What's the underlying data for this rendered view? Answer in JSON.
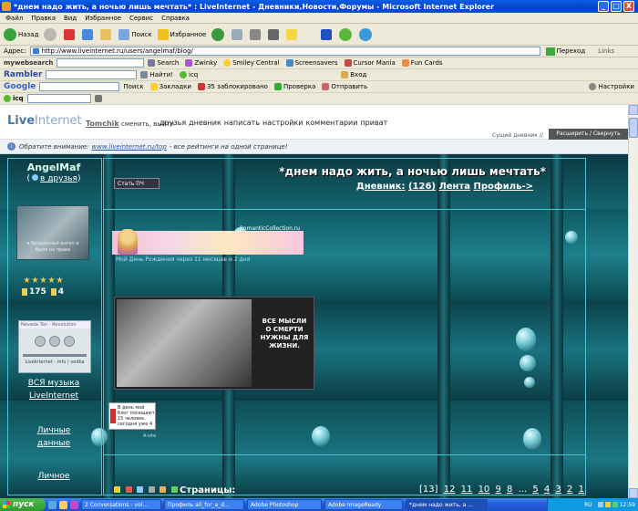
{
  "window": {
    "title": "*днем надо жить, а ночью лишь мечтать* : LiveInternet - Дневники,Новости,Форумы - Microsoft Internet Explorer",
    "controls": [
      "_",
      "□",
      "X"
    ]
  },
  "menu": [
    "Файл",
    "Правка",
    "Вид",
    "Избранное",
    "Сервис",
    "Справка"
  ],
  "toolbar": {
    "back": "Назад",
    "search": "Поиск",
    "favorites": "Избранное"
  },
  "address": {
    "label": "Адрес:",
    "url": "http://www.liveinternet.ru/users/angelmaf/blog/",
    "go": "Переход",
    "links": "Links"
  },
  "mywebsearch": {
    "brand": "mywebsearch",
    "search": "Search",
    "items": [
      "Zwinky",
      "Smiley Central",
      "Screensavers",
      "Cursor Mania",
      "Fun Cards"
    ]
  },
  "rambler": {
    "brand": "Rambler",
    "find": "Найти!",
    "icq": "icq",
    "login": "Вход"
  },
  "google": {
    "brand": "Google",
    "search": "Поиск",
    "bookmarks": "Закладки",
    "blocked": "35 заблокировано",
    "check": "Проверка",
    "send": "Отправить",
    "settings": "Настройки"
  },
  "icqbar": {
    "brand": "icq"
  },
  "liveinternet": {
    "logo_a": "Live",
    "logo_b": "Internet",
    "user": "Tomchik",
    "user_actions": "сменить, выйти",
    "nav": [
      "друзья",
      "дневник",
      "написать",
      "настройки",
      "комментарии",
      "приват"
    ],
    "diary_type": "Сущий дневник //",
    "expand": "Расширить / Свернуть"
  },
  "notice": {
    "prefix": "Обратите внимание:",
    "link": "www.liveinternet.ru/top",
    "suffix": "- все рейтинги на одной странице!"
  },
  "blog": {
    "author": "AngelMaf",
    "add_friend_paren_open": "(",
    "add_friend": "в друзья",
    "add_friend_paren_close": ")",
    "avatar_caption": "в брошенный ангел и быля не права",
    "stars": 5,
    "rating_1": "175",
    "rating_2": "4",
    "player_title": "Nevada Tan - Revolution",
    "player_label": "LiveInternet - mfu | vedka",
    "music_link_1": "ВСЯ музыка",
    "music_link_2": "LiveInternet",
    "personal_data_1": "Личные",
    "personal_data_2": "данные",
    "personal_3": "Личное",
    "stat_button": "Стать ПЧ",
    "title": "*днем надо жить, а ночью лишь мечтать*",
    "diary_link": "Дневник:",
    "diary_count": "(126)",
    "feed_link": "Лента",
    "profile_link": "Профиль->",
    "bday_logo": "RomanticCollection.ru",
    "bday_text": "Мой День Рождения через 11 месяцев и 2 дня",
    "photo_quote": "ВСЕ МЫСЛИ О СМЕРТИ НУЖНЫ ДЛЯ ЖИЗНИ.",
    "counter_text": "В день мой блог посещают 15 человек, сегодня уже 4",
    "counter_foot": "A-site",
    "pages_label": "Страницы:",
    "pages": [
      "[13]",
      "12",
      "11",
      "10",
      "9",
      "8",
      "...",
      "5",
      "4",
      "3",
      "2",
      "1"
    ]
  },
  "taskbar": {
    "start": "пуск",
    "tasks": [
      "2 Conversations - vol...",
      "Профиль all_for_a_d...",
      "Adobe Photoshop",
      "Adobe ImageReady",
      "*днем надо жить, а ..."
    ],
    "lang": "RU",
    "time": "12:59"
  }
}
